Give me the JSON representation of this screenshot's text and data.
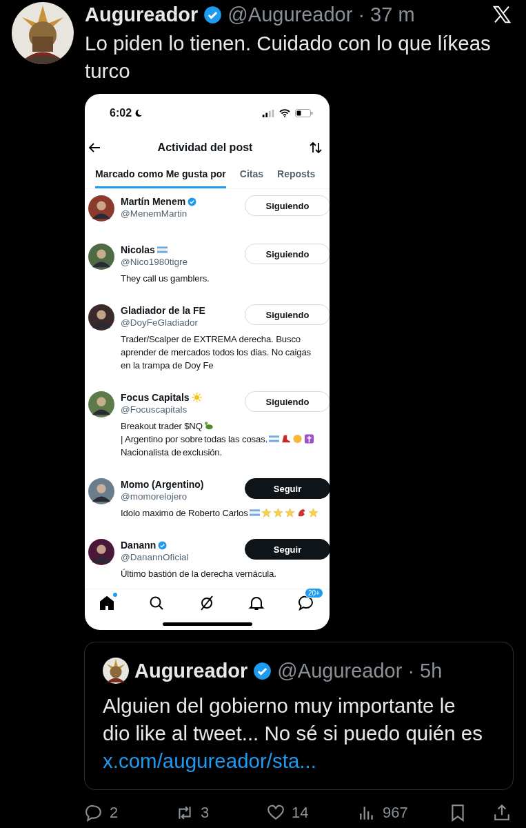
{
  "tweet": {
    "author": {
      "name": "Augureador",
      "verified": true,
      "handle_time": "@Augureador · 37 m"
    },
    "text": "Lo piden lo tienen. Cuidado con lo que líkeas turco"
  },
  "embedded_screenshot": {
    "status_bar": {
      "time": "6:02"
    },
    "header": {
      "title": "Actividad del post"
    },
    "tabs": [
      {
        "label": "Marcado como Me gusta por",
        "selected": true
      },
      {
        "label": "Citas",
        "selected": false
      },
      {
        "label": "Reposts",
        "selected": false
      }
    ],
    "users": [
      {
        "name": "Martín Menem",
        "verified": true,
        "handle": "@MenemMartin",
        "following": true,
        "button": "Siguiendo"
      },
      {
        "name": "Nicolas",
        "verified": false,
        "name_emoji": [
          {
            "kind": "flag"
          }
        ],
        "handle": "@Nico1980tigre",
        "following": true,
        "button": "Siguiendo",
        "bio": [
          {
            "kind": "text",
            "text": "They call us gamblers."
          }
        ]
      },
      {
        "name": "Gladiador de la FE",
        "verified": false,
        "handle": "@DoyFeGladiador",
        "following": true,
        "button": "Siguiendo",
        "bio": [
          {
            "kind": "text",
            "text": "Trader/Scalper de EXTREMA derecha. Busco aprender de mercados todos los dias. No caigas en la trampa de Doy Fe"
          }
        ]
      },
      {
        "name": "Focus Capitals",
        "verified": false,
        "name_emoji": [
          {
            "kind": "sun"
          }
        ],
        "handle": "@Focuscapitals",
        "following": true,
        "button": "Siguiendo",
        "bio": [
          {
            "kind": "text",
            "text": "Breakout trader $NQ"
          },
          {
            "kind": "turtle"
          },
          {
            "kind": "text",
            "text": "| Argentino por sobre"
          },
          {
            "kind": "text",
            "text": "todas las cosas."
          },
          {
            "kind": "flag"
          },
          {
            "kind": "boot"
          },
          {
            "kind": "face"
          },
          {
            "kind": "cross"
          },
          {
            "kind": "text",
            "text": "Nacionalista de"
          },
          {
            "kind": "text",
            "text": "exclusión."
          }
        ]
      },
      {
        "name": "Momo (Argentino)",
        "verified": false,
        "handle": "@momorelojero",
        "following": false,
        "button": "Seguir",
        "bio": [
          {
            "kind": "text",
            "text": "Idolo maximo de Roberto Carlos"
          },
          {
            "kind": "flag"
          },
          {
            "kind": "star"
          },
          {
            "kind": "star"
          },
          {
            "kind": "star"
          },
          {
            "kind": "creature"
          },
          {
            "kind": "star"
          }
        ]
      },
      {
        "name": "Danann",
        "verified": true,
        "handle": "@DanannOficial",
        "following": false,
        "button": "Seguir",
        "bio": [
          {
            "kind": "text",
            "text": "Último bastión de la derecha vernácula."
          }
        ]
      }
    ],
    "nav": [
      {
        "kind": "home",
        "selected": true
      },
      {
        "kind": "search",
        "selected": false
      },
      {
        "kind": "grok",
        "selected": false
      },
      {
        "kind": "bell",
        "selected": false
      },
      {
        "kind": "messages",
        "selected": false,
        "badge": "20+"
      }
    ]
  },
  "quoted_tweet": {
    "author": {
      "name": "Augureador",
      "verified": true,
      "handle_time": "@Augureador · 5h"
    },
    "text": "Alguien del gobierno muy importante le dio like al tweet... No sé si puedo quién es",
    "link": "x.com/augureador/sta..."
  },
  "actions": [
    {
      "kind": "reply",
      "count": "2"
    },
    {
      "kind": "retweet",
      "count": "3"
    },
    {
      "kind": "like",
      "count": "14"
    },
    {
      "kind": "views",
      "count": "967"
    },
    {
      "kind": "bookmark"
    },
    {
      "kind": "share"
    }
  ]
}
